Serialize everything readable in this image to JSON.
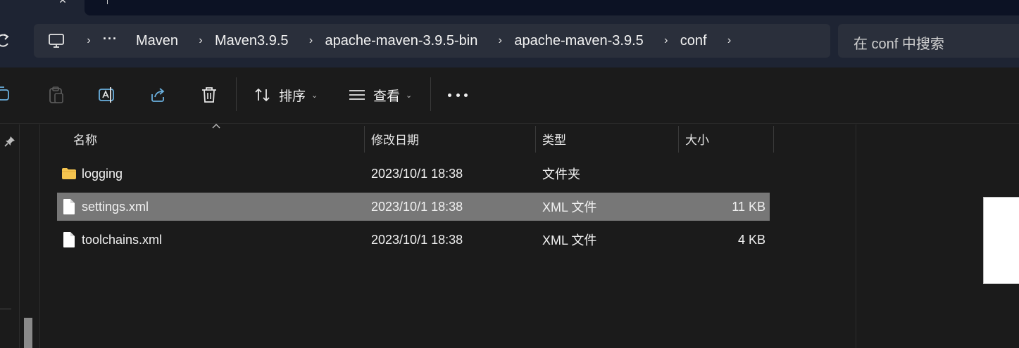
{
  "address": {
    "crumbs": [
      "Maven",
      "Maven3.9.5",
      "apache-maven-3.9.5-bin",
      "apache-maven-3.9.5",
      "conf"
    ],
    "overflow": "···",
    "chevron": "›"
  },
  "search": {
    "placeholder": "在 conf 中搜索"
  },
  "toolbar": {
    "sort_label": "排序",
    "view_label": "查看",
    "dropdown": "⌄",
    "icons": [
      "copy-icon",
      "paste-icon",
      "rename-icon",
      "share-icon",
      "delete-icon",
      "sort-icon",
      "view-icon",
      "more-icon"
    ]
  },
  "columns": {
    "name": "名称",
    "modified": "修改日期",
    "type": "类型",
    "size": "大小"
  },
  "files": [
    {
      "name": "logging",
      "modified": "2023/10/1 18:38",
      "type": "文件夹",
      "size": "",
      "icon": "folder-icon"
    },
    {
      "name": "settings.xml",
      "modified": "2023/10/1 18:38",
      "type": "XML 文件",
      "size": "11 KB",
      "icon": "file-icon",
      "selected": true
    },
    {
      "name": "toolchains.xml",
      "modified": "2023/10/1 18:38",
      "type": "XML 文件",
      "size": "4 KB",
      "icon": "file-icon"
    }
  ],
  "colors": {
    "chrome": "#1e2433",
    "content": "#1b1b1b",
    "selected_row": "#777777",
    "folder": "#f4c44f",
    "accent_icon": "#6ab0de"
  }
}
